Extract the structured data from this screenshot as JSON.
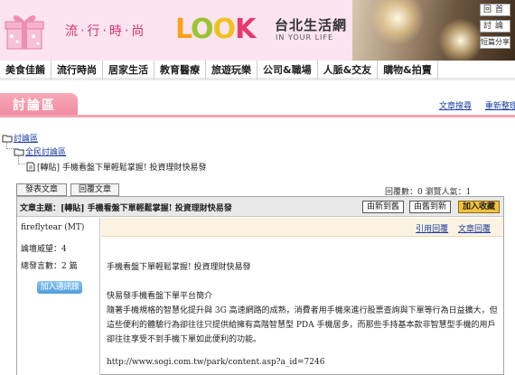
{
  "header": {
    "slogan": "流‧行‧時‧尚",
    "logo": {
      "part1": "L",
      "part2": "O",
      "part3": "O",
      "part4": "K"
    },
    "site_name": "台北生活網",
    "site_sub": "IN YOUR LIFE",
    "buttons": [
      "回首",
      "討論",
      "短篇分享"
    ]
  },
  "nav": {
    "items": [
      "美食佳餚",
      "流行時尚",
      "居家生活",
      "教育醫療",
      "旅遊玩樂",
      "公司&職場",
      "人脈&交友",
      "購物&拍賣"
    ],
    "active": "流行時尚"
  },
  "section": {
    "title": "討論區",
    "links": [
      "文章搜尋",
      "重新整理"
    ]
  },
  "breadcrumb": {
    "root": "討論區",
    "level1": "全民討論區",
    "level2": "[轉貼] 手機看盤下單輕鬆掌握! 投資理財快易發"
  },
  "actions": {
    "post": "發表文章",
    "reply": "回覆文章",
    "counts": "回覆數：0    瀏覽人氣：1"
  },
  "topic": {
    "label": "文章主題：",
    "title": "[轉貼] 手機看盤下單輕鬆掌握! 投資理財快易發",
    "buttons": {
      "newest": "由新到舊",
      "oldest": "由舊到新",
      "favorite": "加入收藏"
    }
  },
  "author": {
    "name": "fireflytear (MT)",
    "prestige": "論壇威望：4",
    "total": "總發言數：2 篇",
    "add_friend": "加入通訊錄"
  },
  "post": {
    "links": [
      "引用回覆",
      "文章回覆"
    ],
    "lines": [
      "手機看盤下單輕鬆掌握! 投資理財快易發",
      "快易發手機看盤下單平台簡介",
      "隨著手機規格的智慧化提升與 3G 高速網路的成熟，消費者用手機來進行股票查詢與下單等行為日益擴大，但",
      "這些便利的體驗行為卻往往只提供給擁有高階智慧型 PDA 手機居多，而那些手持基本款非智慧型手機的用戶",
      "卻往往享受不到手機下單如此便利的功能。",
      "http://www.sogi.com.tw/park/content.asp?a_id=7246"
    ]
  }
}
